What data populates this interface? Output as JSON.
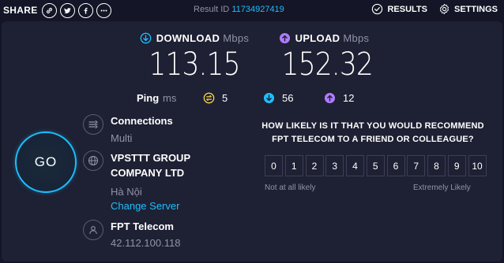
{
  "topbar": {
    "share_label": "SHARE",
    "share_buttons": [
      "link-icon",
      "twitter-icon",
      "facebook-icon",
      "more-icon"
    ],
    "result_id_label": "Result ID",
    "result_id_value": "11734927419",
    "results_label": "RESULTS",
    "settings_label": "SETTINGS"
  },
  "download": {
    "label": "DOWNLOAD",
    "unit": "Mbps",
    "value": "113.15"
  },
  "upload": {
    "label": "UPLOAD",
    "unit": "Mbps",
    "value": "152.32"
  },
  "ping": {
    "label": "Ping",
    "unit": "ms",
    "idle": "5",
    "download": "56",
    "upload": "12"
  },
  "go_label": "GO",
  "connections": {
    "title": "Connections",
    "value": "Multi"
  },
  "server": {
    "title_line1": "VPSTTT GROUP",
    "title_line2": "COMPANY LTD",
    "location": "Hà Nội",
    "change_link": "Change Server"
  },
  "provider": {
    "title": "FPT Telecom",
    "ip": "42.112.100.118"
  },
  "survey": {
    "question_line1": "HOW LIKELY IS IT THAT YOU WOULD RECOMMEND",
    "question_line2": "FPT TELECOM TO A FRIEND OR COLLEAGUE?",
    "scale": [
      "0",
      "1",
      "2",
      "3",
      "4",
      "5",
      "6",
      "7",
      "8",
      "9",
      "10"
    ],
    "low_label": "Not at all likely",
    "high_label": "Extremely Likely"
  },
  "colors": {
    "background": "#141526",
    "panel": "#1e2033",
    "accent_cyan": "#1cbfff",
    "upload_purple": "#b07bff",
    "ping_yellow": "#f7d54a",
    "muted_text": "#9193a8"
  }
}
